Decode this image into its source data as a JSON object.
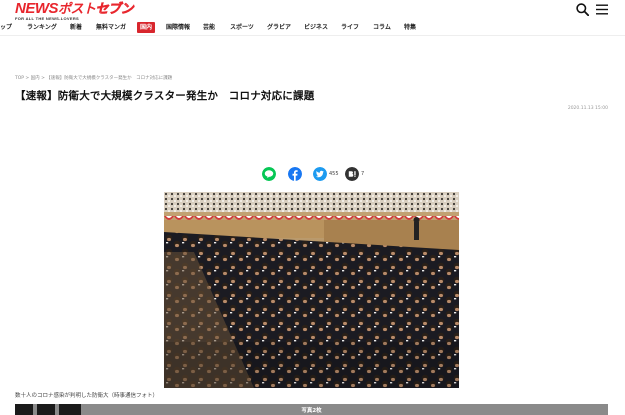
{
  "header": {
    "logo_news": "NEWS",
    "logo_post": "ポスト",
    "logo_seven": "セブン",
    "logo_tagline": "FOR ALL THE NEWS-LOVERS",
    "icons": [
      "search-icon",
      "menu-icon"
    ]
  },
  "nav": {
    "items": [
      "ップ",
      "ランキング",
      "新着",
      "無料マンガ",
      "国内",
      "国際情報",
      "芸能",
      "スポーツ",
      "グラビア",
      "ビジネス",
      "ライフ",
      "コラム",
      "特集"
    ],
    "active": "国内",
    "active_color": "#d8262d"
  },
  "article": {
    "breadcrumb": "TOP > 国内 > 【速報】防衛大で大規模クラスター発生か　コロナ対応に課題",
    "title": "【速報】防衛大で大規模クラスター発生か　コロナ対応に課題",
    "date": "2020.11.13 15:00",
    "shares": {
      "line_icon": "line-icon",
      "facebook_icon": "facebook-icon",
      "twitter_icon": "twitter-icon",
      "twitter_count": "455",
      "hatena_icon": "hatena-icon",
      "hatena_count": "7"
    },
    "photo_caption": "数十人のコロナ感染が判明した防衛大（時事通信フォト）",
    "photo_bar_label": "写真2枚"
  }
}
